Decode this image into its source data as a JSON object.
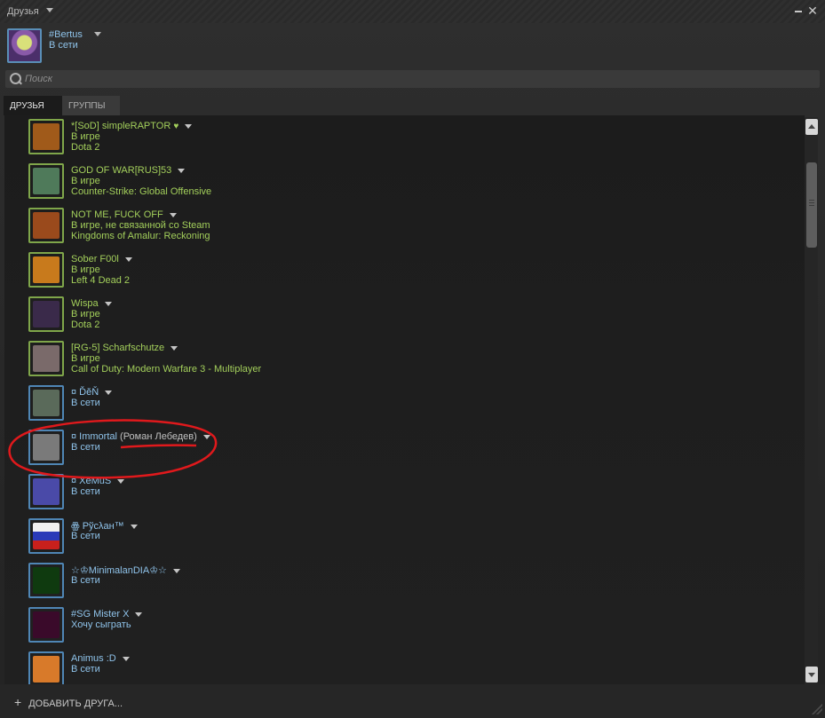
{
  "window": {
    "title": "Друзья"
  },
  "profile": {
    "name": "#Bertus",
    "status": "В сети"
  },
  "search": {
    "placeholder": "Поиск",
    "value": ""
  },
  "tabs": [
    {
      "label": "ДРУЗЬЯ"
    },
    {
      "label": "ГРУППЫ"
    }
  ],
  "friends": [
    {
      "name": "*[SoD] simpleRAPTOR",
      "heart": "♥",
      "status": "В игре",
      "game": "Dota 2",
      "state": "ingame",
      "avatar_color": "#a05a1a"
    },
    {
      "name": "GOD OF WAR[RUS]53",
      "status": "В игре",
      "game": "Counter-Strike: Global Offensive",
      "state": "ingame",
      "avatar_color": "#4f7a5a"
    },
    {
      "name": "NOT ME, FUCK OFF",
      "status": "В игре, не связанной со Steam",
      "game": "Kingdoms of Amalur: Reckoning",
      "state": "ingame",
      "avatar_color": "#9a4a1c"
    },
    {
      "name": "Sober F00l",
      "status": "В игре",
      "game": "Left 4 Dead 2",
      "state": "ingame",
      "avatar_color": "#c87a1c"
    },
    {
      "name": "Wispa",
      "status": "В игре",
      "game": "Dota 2",
      "state": "ingame",
      "avatar_color": "#3a2a4a"
    },
    {
      "name": "[RG-5] Scharfschutze",
      "status": "В игре",
      "game": "Call of Duty: Modern Warfare 3 - Multiplayer",
      "state": "ingame",
      "avatar_color": "#7a6a6a"
    },
    {
      "name": "¤ ĎěŇ",
      "status": "В сети",
      "state": "online",
      "avatar_color": "#5a6a5a"
    },
    {
      "name": "¤ Immortal",
      "real_name": "(Роман Лебедев)",
      "status": "В сети",
      "state": "online",
      "avatar_color": "#7a7a7a"
    },
    {
      "name": "¤ XeMuS",
      "status": "В сети",
      "state": "online",
      "avatar_color": "#4a4aa8"
    },
    {
      "name": "ꙮ Рўсλан™",
      "status": "В сети",
      "state": "online",
      "avatar_color": "#2a3ab8"
    },
    {
      "name": "☆♔MinimalanDIA♔☆",
      "status": "В сети",
      "state": "online",
      "avatar_color": "#0f3a0f"
    },
    {
      "name": "#SG Mister X",
      "status": "Хочу сыграть",
      "state": "online",
      "avatar_color": "#3a0a2a"
    },
    {
      "name": "Animus :D",
      "status": "В сети",
      "state": "online",
      "avatar_color": "#d87a2a"
    }
  ],
  "footer": {
    "add_friend_label": "ДОБАВИТЬ ДРУГА..."
  },
  "colors": {
    "ingame": "#a3cf5b",
    "online": "#8fc3ea",
    "annotation": "#e0191c"
  }
}
